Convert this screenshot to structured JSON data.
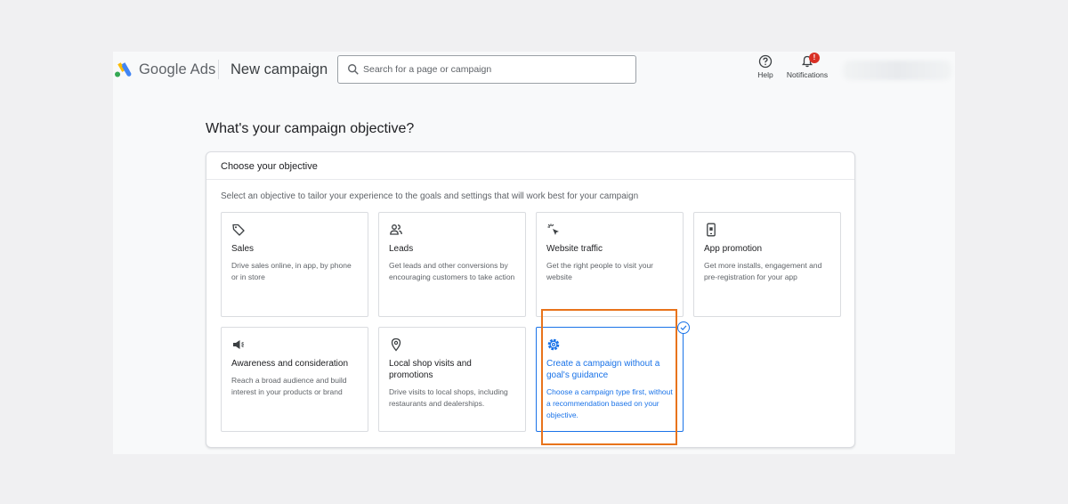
{
  "header": {
    "brand": "Google",
    "product": "Ads",
    "page_title": "New campaign",
    "search_placeholder": "Search for a page or campaign",
    "help_label": "Help",
    "notifications_label": "Notifications",
    "notifications_badge": "!"
  },
  "main": {
    "heading": "What's your campaign objective?",
    "card_title": "Choose your objective",
    "card_description": "Select an objective to tailor your experience to the goals and settings that will work best for your campaign",
    "objectives": [
      {
        "title": "Sales",
        "description": "Drive sales online, in app, by phone or in store",
        "icon": "tag-icon"
      },
      {
        "title": "Leads",
        "description": "Get leads and other conversions by encouraging customers to take action",
        "icon": "people-icon"
      },
      {
        "title": "Website traffic",
        "description": "Get the right people to visit your website",
        "icon": "cursor-click-icon"
      },
      {
        "title": "App promotion",
        "description": "Get more installs, engagement and pre-registration for your app",
        "icon": "phone-icon"
      },
      {
        "title": "Awareness and consideration",
        "description": "Reach a broad audience and build interest in your products or brand",
        "icon": "megaphone-icon"
      },
      {
        "title": "Local shop visits and promotions",
        "description": "Drive visits to local shops, including restaurants and dealerships.",
        "icon": "location-pin-icon"
      },
      {
        "title": "Create a campaign without a goal's guidance",
        "description": "Choose a campaign type first, without a recommendation based on your objective.",
        "icon": "gear-icon",
        "selected": true
      }
    ]
  },
  "colors": {
    "accent": "#1a73e8",
    "highlight": "#e8731b",
    "badge": "#d93025"
  }
}
